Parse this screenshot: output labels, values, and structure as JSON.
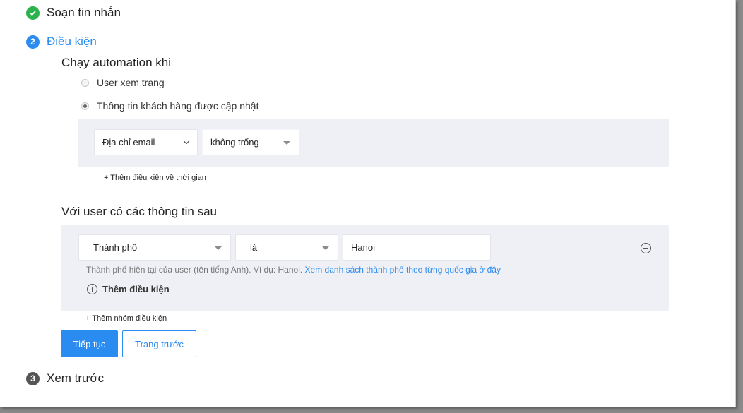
{
  "steps": {
    "step1": {
      "title": "Soạn tin nhắn"
    },
    "step2": {
      "number": "2",
      "title": "Điều kiện"
    },
    "step3": {
      "number": "3",
      "title": "Xem trước"
    }
  },
  "trigger": {
    "title": "Chạy automation khi",
    "options": [
      {
        "label": "User xem trang",
        "checked": false
      },
      {
        "label": "Thông tin khách hàng được cập nhật",
        "checked": true
      }
    ],
    "field_select": "Địa chỉ email",
    "operator_select": "không trống",
    "add_time_condition": "+ Thêm điều kiện về thời gian"
  },
  "audience": {
    "title": "Với user có các thông tin sau",
    "field_select": "Thành phố",
    "operator_select": "là",
    "value_input": "Hanoi",
    "hint_text": "Thành phố hiện tại của user (tên tiếng Anh). Ví dụ: Hanoi.",
    "hint_link": "Xem danh sách thành phố theo từng quốc gia ở đây",
    "add_condition": "Thêm điều kiện",
    "add_group": "+ Thêm nhóm điều kiện"
  },
  "buttons": {
    "continue": "Tiếp tục",
    "previous": "Trang trước"
  },
  "colors": {
    "accent": "#2a8cf0",
    "success": "#2bb24c",
    "panel_bg": "#eef0f5"
  }
}
